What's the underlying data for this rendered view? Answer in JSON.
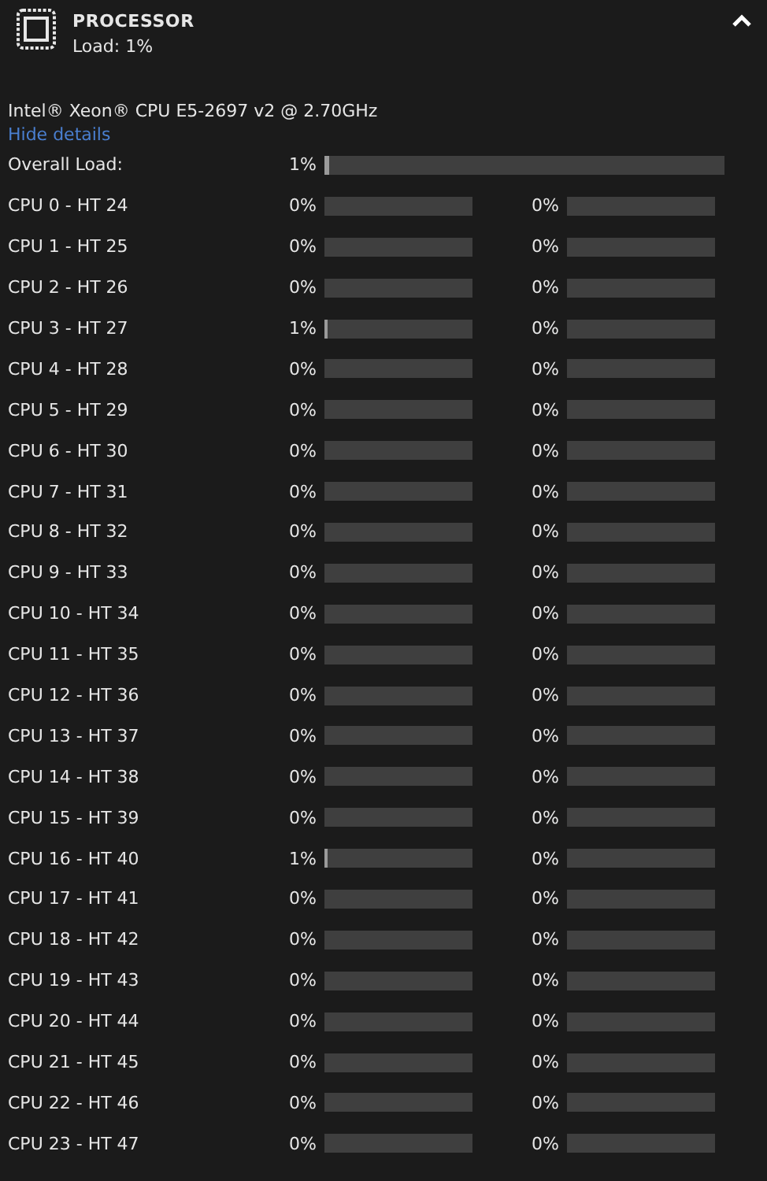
{
  "header": {
    "title": "PROCESSOR",
    "subtitle": "Load: 1%",
    "expanded": true
  },
  "model": "Intel® Xeon® CPU E5-2697 v2 @ 2.70GHz",
  "toggle_link": "Hide details",
  "overall": {
    "label": "Overall Load:",
    "reading": "1%",
    "level": 0.01
  },
  "cpus": [
    {
      "label": "CPU 0 - HT 24",
      "core": {
        "reading": "0%"
      },
      "ht": {
        "reading": "0%"
      }
    },
    {
      "label": "CPU 1 - HT 25",
      "core": {
        "reading": "0%"
      },
      "ht": {
        "reading": "0%"
      }
    },
    {
      "label": "CPU 2 - HT 26",
      "core": {
        "reading": "0%"
      },
      "ht": {
        "reading": "0%"
      }
    },
    {
      "label": "CPU 3 - HT 27",
      "core": {
        "reading": "1%",
        "level": 0.01
      },
      "ht": {
        "reading": "0%"
      }
    },
    {
      "label": "CPU 4 - HT 28",
      "core": {
        "reading": "0%"
      },
      "ht": {
        "reading": "0%"
      }
    },
    {
      "label": "CPU 5 - HT 29",
      "core": {
        "reading": "0%"
      },
      "ht": {
        "reading": "0%"
      }
    },
    {
      "label": "CPU 6 - HT 30",
      "core": {
        "reading": "0%"
      },
      "ht": {
        "reading": "0%"
      }
    },
    {
      "label": "CPU 7 - HT 31",
      "core": {
        "reading": "0%"
      },
      "ht": {
        "reading": "0%"
      }
    },
    {
      "label": "CPU 8 - HT 32",
      "core": {
        "reading": "0%"
      },
      "ht": {
        "reading": "0%"
      }
    },
    {
      "label": "CPU 9 - HT 33",
      "core": {
        "reading": "0%"
      },
      "ht": {
        "reading": "0%"
      }
    },
    {
      "label": "CPU 10 - HT 34",
      "core": {
        "reading": "0%"
      },
      "ht": {
        "reading": "0%"
      }
    },
    {
      "label": "CPU 11 - HT 35",
      "core": {
        "reading": "0%"
      },
      "ht": {
        "reading": "0%"
      }
    },
    {
      "label": "CPU 12 - HT 36",
      "core": {
        "reading": "0%"
      },
      "ht": {
        "reading": "0%"
      }
    },
    {
      "label": "CPU 13 - HT 37",
      "core": {
        "reading": "0%"
      },
      "ht": {
        "reading": "0%"
      }
    },
    {
      "label": "CPU 14 - HT 38",
      "core": {
        "reading": "0%"
      },
      "ht": {
        "reading": "0%"
      }
    },
    {
      "label": "CPU 15 - HT 39",
      "core": {
        "reading": "0%"
      },
      "ht": {
        "reading": "0%"
      }
    },
    {
      "label": "CPU 16 - HT 40",
      "core": {
        "reading": "1%",
        "level": 0.01
      },
      "ht": {
        "reading": "0%"
      }
    },
    {
      "label": "CPU 17 - HT 41",
      "core": {
        "reading": "0%"
      },
      "ht": {
        "reading": "0%"
      }
    },
    {
      "label": "CPU 18 - HT 42",
      "core": {
        "reading": "0%"
      },
      "ht": {
        "reading": "0%"
      }
    },
    {
      "label": "CPU 19 - HT 43",
      "core": {
        "reading": "0%"
      },
      "ht": {
        "reading": "0%"
      }
    },
    {
      "label": "CPU 20 - HT 44",
      "core": {
        "reading": "0%"
      },
      "ht": {
        "reading": "0%"
      }
    },
    {
      "label": "CPU 21 - HT 45",
      "core": {
        "reading": "0%"
      },
      "ht": {
        "reading": "0%"
      }
    },
    {
      "label": "CPU 22 - HT 46",
      "core": {
        "reading": "0%"
      },
      "ht": {
        "reading": "0%"
      }
    },
    {
      "label": "CPU 23 - HT 47",
      "core": {
        "reading": "0%"
      },
      "ht": {
        "reading": "0%"
      }
    }
  ]
}
